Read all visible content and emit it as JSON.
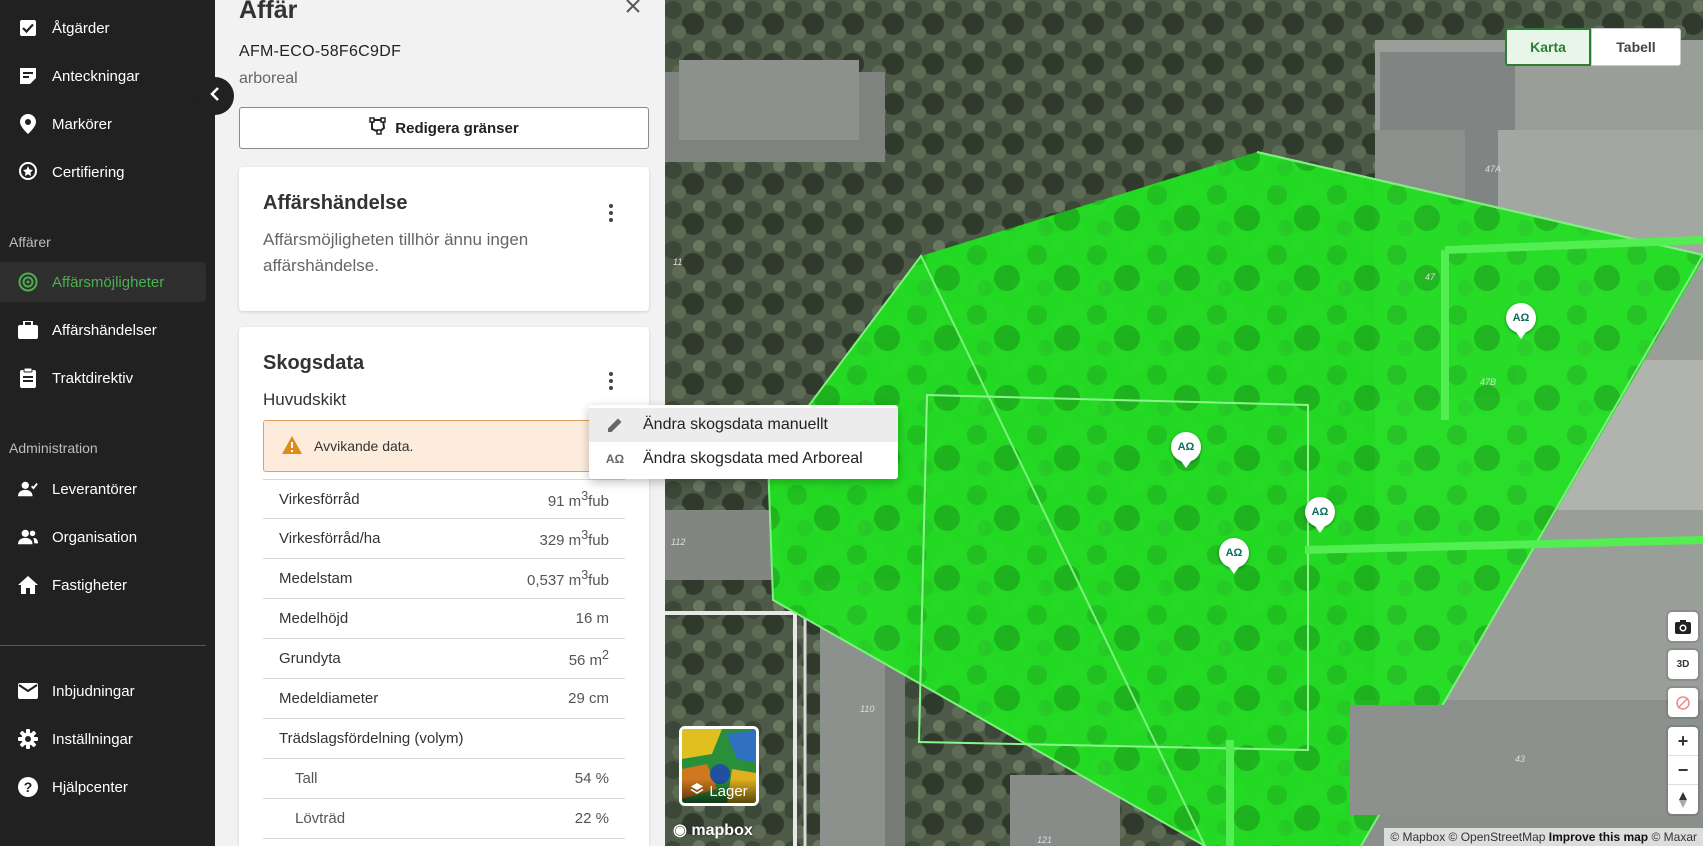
{
  "sidebar": {
    "items_top": [
      {
        "label": "Åtgärder",
        "icon": "checkbox-icon"
      },
      {
        "label": "Anteckningar",
        "icon": "note-icon"
      },
      {
        "label": "Markörer",
        "icon": "pin-icon"
      },
      {
        "label": "Certifiering",
        "icon": "certificate-icon"
      }
    ],
    "section_deals": "Affärer",
    "items_deals": [
      {
        "label": "Affärsmöjligheter",
        "icon": "target-icon"
      },
      {
        "label": "Affärshändelser",
        "icon": "briefcase-icon"
      },
      {
        "label": "Traktdirektiv",
        "icon": "clipboard-icon"
      }
    ],
    "section_admin": "Administration",
    "items_admin": [
      {
        "label": "Leverantörer",
        "icon": "supplier-icon"
      },
      {
        "label": "Organisation",
        "icon": "people-icon"
      },
      {
        "label": "Fastigheter",
        "icon": "home-icon"
      }
    ],
    "items_bottom": [
      {
        "label": "Inbjudningar",
        "icon": "mail-icon"
      },
      {
        "label": "Inställningar",
        "icon": "gear-icon"
      },
      {
        "label": "Hjälpcenter",
        "icon": "help-icon"
      }
    ],
    "accent_color": "#4caf50"
  },
  "panel": {
    "title": "Affär",
    "deal_id": "AFM-ECO-58F6C9DF",
    "owner": "arboreal",
    "edit_button": "Redigera gränser",
    "event_card": {
      "title": "Affärshändelse",
      "text": "Affärsmöjligheten tillhör ännu ingen affärshändelse."
    },
    "forest_card": {
      "title": "Skogsdata",
      "subtitle": "Huvudskikt",
      "warning": "Avvikande data.",
      "rows": [
        {
          "label": "Virkesförråd",
          "value": "91 m",
          "sup": "3",
          "unit": "fub"
        },
        {
          "label": "Virkesförråd/ha",
          "value": "329 m",
          "sup": "3",
          "unit": "fub"
        },
        {
          "label": "Medelstam",
          "value": "0,537 m",
          "sup": "3",
          "unit": "fub"
        },
        {
          "label": "Medelhöjd",
          "value": "16 m",
          "sup": "",
          "unit": ""
        },
        {
          "label": "Grundyta",
          "value": "56 m",
          "sup": "2",
          "unit": ""
        },
        {
          "label": "Medeldiameter",
          "value": "29 cm",
          "sup": "",
          "unit": ""
        },
        {
          "label": "Trädslagsfördelning (volym)",
          "value": "",
          "sup": "",
          "unit": ""
        },
        {
          "label": "Tall",
          "value": "54 %",
          "sup": "",
          "unit": "",
          "indent": true
        },
        {
          "label": "Lövträd",
          "value": "22 %",
          "sup": "",
          "unit": "",
          "indent": true
        }
      ]
    }
  },
  "context_menu": {
    "items": [
      {
        "label": "Ändra skogsdata manuellt",
        "icon": "pencil-icon"
      },
      {
        "label": "Ändra skogsdata med Arboreal",
        "icon": "arboreal-icon",
        "icon_text": "AΩ"
      }
    ]
  },
  "map": {
    "view_toggle": {
      "map": "Karta",
      "table": "Tabell"
    },
    "layer_button": "Lager",
    "marker_text": "AΩ",
    "logo": "mapbox",
    "attribution": {
      "mapbox": "© Mapbox",
      "osm": "© OpenStreetMap",
      "improve": "Improve this map",
      "maxar": "© Maxar"
    },
    "building_labels": [
      "47A",
      "47",
      "47B",
      "11",
      "112",
      "110",
      "43",
      "121"
    ],
    "polygon_color": "#1fdc1f"
  }
}
